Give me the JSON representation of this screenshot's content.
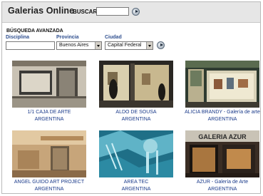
{
  "header": {
    "site_title": "Galerias Online",
    "search_label": "BUSCAR",
    "search_value": ""
  },
  "advanced_search": {
    "title": "BÚSQUEDA AVANZADA",
    "discipline_label": "Disciplina",
    "discipline_value": "",
    "province_label": "Provincia",
    "province_value": "Buenos Aires",
    "city_label": "Ciudad",
    "city_value": "Capital Federal"
  },
  "galleries": [
    {
      "line1": "1/1 CAJA DE ARTE",
      "line2": "ARGENTINA"
    },
    {
      "line1": "ALDO DE SOUSA",
      "line2": "ARGENTINA"
    },
    {
      "line1": "ALICIA BRANDY - Galería de arte",
      "line2": "ARGENTINA"
    },
    {
      "line1": "ANGEL GUIDO ART PROJECT",
      "line2": "ARGENTINA"
    },
    {
      "line1": "AREA TEC",
      "line2": "ARGENTINA"
    },
    {
      "line1": "AZUR - Galería de Arte",
      "line2": "ARGENTINA"
    }
  ],
  "photo_signs": {
    "azur_sign": "GALERIA AZUR"
  },
  "icons": {
    "go": "play-arrow-circle-icon",
    "dropdown": "chevron-down-icon"
  }
}
